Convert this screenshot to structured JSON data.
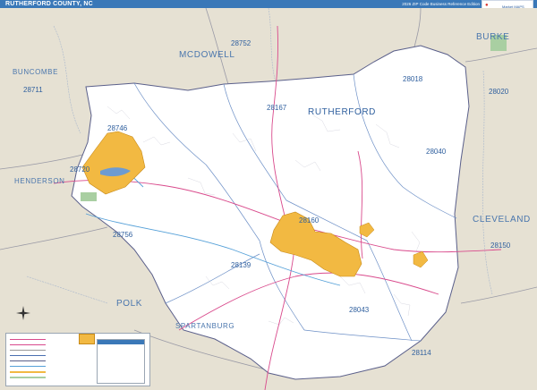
{
  "header": {
    "title": "RUTHERFORD COUNTY, NC",
    "edition": "2026 ZIP Code Business Reference Edition",
    "logo": "Market MAPS"
  },
  "map": {
    "main_county": "RUTHERFORD",
    "neighbor_counties": [
      "BUNCOMBE",
      "MCDOWELL",
      "BURKE",
      "HENDERSON",
      "POLK",
      "CLEVELAND",
      "SPARTANBURG"
    ],
    "zip_codes": [
      "28752",
      "28711",
      "28018",
      "28020",
      "28167",
      "28746",
      "28720",
      "28040",
      "28160",
      "28756",
      "28139",
      "28150",
      "28043",
      "28114"
    ],
    "colors": {
      "background": "#e8e3d6",
      "county_fill": "#ffffff",
      "town_fill": "#f2b942",
      "water": "#6d9bd1",
      "label": "#2f5f9e",
      "road": "#d94a8c",
      "boundary": "#4a6fb0"
    }
  },
  "legend": {
    "title": "ZIP Code Index/Cities Legend"
  }
}
